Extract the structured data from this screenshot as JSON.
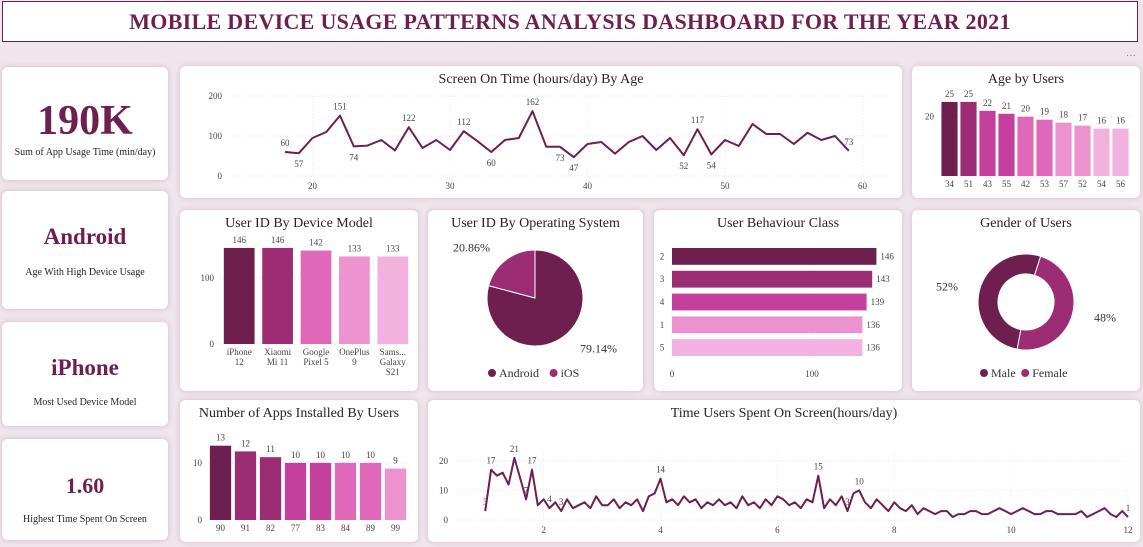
{
  "title": "MOBILE DEVICE USAGE PATTERNS ANALYSIS  DASHBOARD FOR THE YEAR  2021",
  "kpis": [
    {
      "value": "190K",
      "label": "Sum of App Usage Time (min/day)"
    },
    {
      "value": "Android",
      "label": "Age With High Device Usage"
    },
    {
      "value": "iPhone",
      "label": "Most Used Device Model"
    },
    {
      "value": "1.60",
      "label": "Highest Time Spent On Screen"
    }
  ],
  "colors": {
    "dark": "#6e1f4f",
    "c2": "#9c2c74",
    "c3": "#c4409c",
    "c4": "#e068bb",
    "c5": "#ec93cf",
    "c6": "#f2b1de"
  },
  "more_icon": "…",
  "chart_data": [
    {
      "id": "screen_on_time",
      "type": "line",
      "title": "Screen On Time (hours/day) By Age",
      "xlim": [
        14,
        62
      ],
      "ylim": [
        0,
        200
      ],
      "xticks": [
        20,
        30,
        40,
        50,
        60
      ],
      "yticks": [
        0,
        100,
        200
      ],
      "x": [
        18,
        19,
        20,
        21,
        22,
        23,
        24,
        25,
        26,
        27,
        28,
        29,
        30,
        31,
        32,
        33,
        34,
        35,
        36,
        37,
        38,
        39,
        40,
        41,
        42,
        43,
        44,
        45,
        46,
        47,
        48,
        49,
        50,
        51,
        52,
        53,
        54,
        55,
        56,
        57,
        58,
        59
      ],
      "y": [
        60,
        57,
        95,
        110,
        151,
        74,
        76,
        90,
        64,
        122,
        70,
        90,
        65,
        112,
        87,
        60,
        90,
        95,
        162,
        73,
        73,
        47,
        80,
        85,
        56,
        85,
        100,
        65,
        95,
        52,
        117,
        54,
        90,
        75,
        130,
        105,
        105,
        80,
        108,
        90,
        100,
        63
      ],
      "labels": [
        {
          "i": 0,
          "t": "60",
          "pos": "above"
        },
        {
          "i": 1,
          "t": "57",
          "pos": "below"
        },
        {
          "i": 4,
          "t": "151",
          "pos": "above"
        },
        {
          "i": 5,
          "t": "74",
          "pos": "below"
        },
        {
          "i": 9,
          "t": "122",
          "pos": "above"
        },
        {
          "i": 13,
          "t": "112",
          "pos": "above"
        },
        {
          "i": 15,
          "t": "60",
          "pos": "below"
        },
        {
          "i": 18,
          "t": "162",
          "pos": "above"
        },
        {
          "i": 20,
          "t": "73",
          "pos": "below"
        },
        {
          "i": 21,
          "t": "47",
          "pos": "below"
        },
        {
          "i": 29,
          "t": "52",
          "pos": "below"
        },
        {
          "i": 30,
          "t": "117",
          "pos": "above"
        },
        {
          "i": 31,
          "t": "54",
          "pos": "below"
        },
        {
          "i": 41,
          "t": "73",
          "pos": "above"
        }
      ]
    },
    {
      "id": "age_by_users",
      "type": "bar",
      "title": "Age by Users",
      "categories": [
        "34",
        "51",
        "43",
        "55",
        "42",
        "53",
        "57",
        "52",
        "54",
        "56"
      ],
      "values": [
        25,
        25,
        22,
        21,
        20,
        19,
        18,
        17,
        16,
        16
      ],
      "ylim": [
        0,
        27
      ],
      "yticks": [
        20
      ]
    },
    {
      "id": "device_model",
      "type": "bar",
      "title": "User ID By Device Model",
      "categories": [
        [
          "iPhone",
          "12"
        ],
        [
          "Xiaomi",
          "Mi 11"
        ],
        [
          "Google",
          "Pixel 5"
        ],
        [
          "OnePlus",
          "9"
        ],
        [
          "Sams...",
          "Galaxy",
          "S21"
        ]
      ],
      "values": [
        146,
        146,
        142,
        133,
        133
      ],
      "ylim": [
        0,
        155
      ],
      "yticks": [
        0,
        100
      ]
    },
    {
      "id": "os",
      "type": "pie",
      "title": "User ID By Operating System",
      "slices": [
        {
          "name": "Android",
          "value": 79.14,
          "label": "79.14%"
        },
        {
          "name": "iOS",
          "value": 20.86,
          "label": "20.86%"
        }
      ],
      "legend": "bottom"
    },
    {
      "id": "behaviour",
      "type": "bar",
      "orientation": "horizontal",
      "title": "User Behaviour Class",
      "categories": [
        "2",
        "3",
        "4",
        "1",
        "5"
      ],
      "values": [
        146,
        143,
        139,
        136,
        136
      ],
      "xlim": [
        0,
        150
      ],
      "xticks": [
        0,
        100
      ]
    },
    {
      "id": "gender",
      "type": "pie",
      "subtype": "donut",
      "title": "Gender of Users",
      "slices": [
        {
          "name": "Male",
          "value": 52,
          "label": "52%"
        },
        {
          "name": "Female",
          "value": 48,
          "label": "48%"
        }
      ],
      "legend": "bottom"
    },
    {
      "id": "apps_installed",
      "type": "bar",
      "title": "Number of Apps Installed By Users",
      "categories": [
        "90",
        "91",
        "82",
        "77",
        "83",
        "84",
        "89",
        "99"
      ],
      "values": [
        13,
        12,
        11,
        10,
        10,
        10,
        10,
        9
      ],
      "ylim": [
        0,
        14
      ],
      "yticks": [
        0,
        10
      ]
    },
    {
      "id": "time_on_screen",
      "type": "line",
      "title": "Time Users Spent On Screen(hours/day)",
      "xlim": [
        0.5,
        12
      ],
      "ylim": [
        0,
        23
      ],
      "xticks": [
        2,
        4,
        6,
        8,
        10,
        12
      ],
      "yticks": [
        0,
        10,
        20
      ],
      "x": [
        1,
        1.1,
        1.2,
        1.3,
        1.4,
        1.5,
        1.6,
        1.7,
        1.8,
        1.9,
        2,
        2.1,
        2.2,
        2.3,
        2.4,
        2.5,
        2.6,
        2.7,
        2.8,
        2.9,
        3,
        3.1,
        3.2,
        3.3,
        3.4,
        3.5,
        3.6,
        3.7,
        3.8,
        3.9,
        4,
        4.1,
        4.2,
        4.3,
        4.4,
        4.5,
        4.6,
        4.7,
        4.8,
        4.9,
        5,
        5.1,
        5.2,
        5.3,
        5.4,
        5.5,
        5.6,
        5.7,
        5.8,
        5.9,
        6,
        6.1,
        6.2,
        6.3,
        6.4,
        6.5,
        6.6,
        6.7,
        6.8,
        6.9,
        7,
        7.1,
        7.2,
        7.3,
        7.4,
        7.5,
        7.6,
        7.7,
        7.8,
        7.9,
        8,
        8.1,
        8.2,
        8.3,
        8.4,
        8.5,
        8.6,
        8.7,
        8.8,
        8.9,
        9,
        9.1,
        9.2,
        9.3,
        9.4,
        9.5,
        9.6,
        9.7,
        9.8,
        9.9,
        10,
        10.1,
        10.2,
        10.3,
        10.4,
        10.5,
        10.6,
        10.7,
        10.8,
        10.9,
        11,
        11.1,
        11.2,
        11.3,
        11.4,
        11.5,
        11.6,
        11.7,
        11.8,
        11.9,
        12
      ],
      "y": [
        3,
        17,
        15,
        16,
        12,
        21,
        14,
        7,
        17,
        5,
        7,
        4,
        6,
        3,
        7,
        4,
        5,
        6,
        4,
        8,
        5,
        5,
        7,
        4,
        6,
        5,
        7,
        3,
        8,
        9,
        14,
        6,
        7,
        5,
        8,
        6,
        7,
        4,
        6,
        5,
        7,
        5,
        6,
        4,
        8,
        5,
        6,
        4,
        7,
        5,
        8,
        7,
        5,
        6,
        4,
        7,
        6,
        15,
        4,
        7,
        5,
        8,
        3,
        9,
        10,
        6,
        4,
        7,
        5,
        3,
        6,
        4,
        3,
        5,
        2,
        4,
        3,
        2,
        3,
        3,
        1,
        2,
        2,
        3,
        3,
        2,
        2,
        3,
        4,
        3,
        2,
        3,
        4,
        3,
        2,
        2,
        3,
        3,
        2,
        2,
        2,
        2,
        3,
        1,
        2,
        3,
        4,
        2,
        1,
        3,
        1
      ],
      "labels": [
        {
          "i": 0,
          "t": "3"
        },
        {
          "i": 1,
          "t": "17"
        },
        {
          "i": 5,
          "t": "21"
        },
        {
          "i": 7,
          "t": "7"
        },
        {
          "i": 8,
          "t": "17"
        },
        {
          "i": 11,
          "t": "4"
        },
        {
          "i": 13,
          "t": "3"
        },
        {
          "i": 30,
          "t": "14"
        },
        {
          "i": 57,
          "t": "15"
        },
        {
          "i": 62,
          "t": "3"
        },
        {
          "i": 64,
          "t": "10"
        },
        {
          "i": 110,
          "t": "1"
        }
      ]
    }
  ]
}
